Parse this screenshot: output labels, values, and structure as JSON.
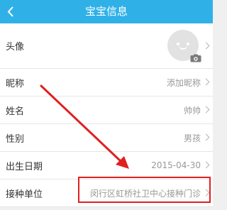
{
  "header": {
    "title": "宝宝信息"
  },
  "rows": {
    "avatar": {
      "label": "头像"
    },
    "nickname": {
      "label": "昵称",
      "value": "添加昵称"
    },
    "name": {
      "label": "姓名",
      "value": "帅帅"
    },
    "gender": {
      "label": "性别",
      "value": "男孩"
    },
    "birthdate": {
      "label": "出生日期",
      "value": "2015-04-30"
    },
    "clinic": {
      "label": "接种单位",
      "value": "闵行区虹桥社卫中心接种门诊"
    }
  },
  "colors": {
    "header_bg": "#2fb1e8",
    "annotation": "#e02020"
  },
  "icons": {
    "back": "back-arrow-icon",
    "chevron": "chevron-right-icon",
    "camera": "camera-icon",
    "avatar": "default-face-avatar"
  }
}
